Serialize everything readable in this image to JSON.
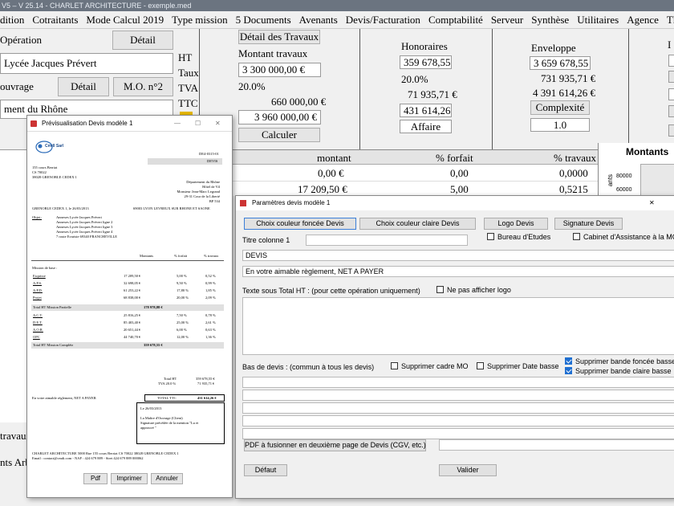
{
  "titlebar": {
    "text": "V5 – V 25.14 - CHARLET ARCHITECTURE - exemple.med"
  },
  "menu": [
    "dition",
    "Cotraitants",
    "Mode Calcul 2019",
    "Type mission",
    "5 Documents",
    "Avenants",
    "Devis/Facturation",
    "Comptabilité",
    "Serveur",
    "Synthèse",
    "Utilitaires",
    "Agence",
    "Thème",
    "?"
  ],
  "left": {
    "operation_label": "Opération",
    "detail_btn": "Détail",
    "operation_value": "Lycée Jacques Prévert",
    "ouvrage_label": "ouvrage",
    "detail2_btn": "Détail",
    "mo_btn": "M.O. n°2",
    "ouvrage_value": "ment du Rhône",
    "travaux_label": "travaux",
    "arb_label": "nts Arb"
  },
  "montant": {
    "labels": {
      "ht": "HT",
      "taux": "Taux",
      "tva": "TVA",
      "ttc": "TTC"
    },
    "detail_travaux_btn": "Détail des Travaux",
    "montant_travaux_label": "Montant travaux",
    "ht_value": "3 300 000,00 €",
    "taux_value": "20.0%",
    "tva_value": "660 000,00 €",
    "ttc_value": "3 960 000,00 €",
    "calculer_btn": "Calculer"
  },
  "honoraires": {
    "title": "Honoraires",
    "ht": "359 678,55 €",
    "taux": "20.0%",
    "tva": "71 935,71 €",
    "ttc": "431 614,26 €",
    "affaire_btn": "Affaire"
  },
  "enveloppe": {
    "title": "Enveloppe",
    "ht": "3 659 678,55 €",
    "tva": "731 935,71 €",
    "ttc": "4 391 614,26 €",
    "complexite_btn": "Complexité",
    "complexite_value": "1.0"
  },
  "far": {
    "label": "I",
    "montants_title": "Montants",
    "chart_ticks": [
      "80000",
      "60000"
    ],
    "rotated": "ants"
  },
  "table": {
    "headers": [
      "montant",
      "% forfait",
      "% travaux"
    ],
    "rows": [
      [
        "0,00 €",
        "0,00",
        "0,0000"
      ],
      [
        "17 209,50 €",
        "5,00",
        "0,5215"
      ]
    ]
  },
  "preview": {
    "title": "Prévisualisation Devis modèle 1",
    "logo": "CmdI Sarl",
    "devis_num": "DE4-0315-01",
    "devis_label": "DEVIS",
    "addr": [
      "155 cours Berriat",
      "CS 70022",
      "38028 GRENOBLE CEDEX 1"
    ],
    "client": [
      "Département du Rhône",
      "Hôtel de Vil",
      "Monsieur Jean-Marc Legrand",
      "29-31 Cour de la Liberté",
      "BP 534"
    ],
    "city_line": "GRENOBLE CEDEX 1, le 26/03/2013",
    "city_right": "69003 LYON LEVREUX SUR RHONE ET SAONE",
    "objet_label": "Objet :",
    "objet": [
      "Annexes Lycée Jacques Prévert",
      "Annexes Lycée Jacques Prévert ligne 2",
      "Annexes Lycée Jacques Prévert ligne 3",
      "Annexes Lycée Jacques Prévert ligne 4",
      "7 route Evariste 69340 FRANCHEVILLE"
    ],
    "cols": [
      "Montants",
      "% forfait",
      "% travaux"
    ],
    "section": "Mission de base :",
    "rows1": [
      [
        "Esquisse",
        "17 209,50 €",
        "5,00 %",
        "0,52 %"
      ],
      [
        "A.P.S.",
        "32 698,05 €",
        "9,50 %",
        "0,99 %"
      ],
      [
        "A.P.D.",
        "61 253,22 €",
        "17,80 %",
        "1,85 %"
      ],
      [
        "Projet",
        "68 838,00 €",
        "20,00 %",
        "2,09 %"
      ]
    ],
    "total1": [
      "Total HT Mission Partielle",
      "178 978,88 €"
    ],
    "rows2": [
      [
        "A.C.T.",
        "25 816,25 €",
        "7,50 %",
        "0,78 %"
      ],
      [
        "D.E.T.",
        "85 403,40 €",
        "25,00 %",
        "2,61 %"
      ],
      [
        "A.O.R.",
        "20 651,44 €",
        "6,00 %",
        "0,63 %"
      ],
      [
        "OPC",
        "44 740,70 €",
        "12,00 %",
        "1,36 %"
      ]
    ],
    "total2": [
      "Total HT Mission Complète",
      "359 678,55 €"
    ],
    "total_ht_label": "Total HT",
    "total_ht": "359 678,55 €",
    "tva_label": "TVA 20.0 %",
    "tva": "71 935,71 €",
    "net": "En votre aimable règlement, NET A PAYER",
    "total_ttc_label": "TOTAL TTC",
    "total_ttc": "431 614,26 €",
    "sig": [
      "Le 26/03/2013",
      "",
      "La Maître d'Ouvrage (Client)",
      "Signature précédée de la mention \"Lu et",
      "approuvé \""
    ],
    "footer1": "CHARLET ARCHITECTURE 5000 Rue 155 cours Berriat CS 70022 38028 GRENOBLE CEDEX 1",
    "footer2": "Email : contact@cmdi.com - NAF : 424 679 889 - Siret 424 679 889 000062",
    "buttons": [
      "Pdf",
      "Imprimer",
      "Annuler"
    ],
    "win_ctrl": [
      "—",
      "☐",
      "✕"
    ]
  },
  "params": {
    "title": "Paramètres devis modèle 1",
    "close": "✕",
    "btn_fonce": "Choix couleur foncée Devis",
    "btn_claire": "Choix couleur claire Devis",
    "btn_logo": "Logo Devis",
    "btn_signature": "Signature Devis",
    "titre_col_label": "Titre colonne 1",
    "titre_col_value": "",
    "bureau": "Bureau d'Etudes",
    "cabinet": "Cabinet d'Assistance à la MO",
    "devis_value": "DEVIS",
    "reglement_value": "En votre aimable règlement, NET A PAYER",
    "texte_sous": "Texte sous Total HT  : (pour cette opération uniquement)",
    "ne_pas_logo": "Ne pas afficher logo",
    "bas_devis": "Bas de devis : (commun à tous les devis)",
    "suppr_cadre": "Supprimer cadre MO",
    "suppr_date": "Supprimer Date basse",
    "suppr_fonce": "Supprimer bande foncée basse",
    "suppr_claire": "Supprimer bande claire basse",
    "btn_pdf": "PDF à fusionner en deuxième page de Devis (CGV, etc.)",
    "btn_defaut": "Défaut",
    "btn_valider": "Valider"
  }
}
